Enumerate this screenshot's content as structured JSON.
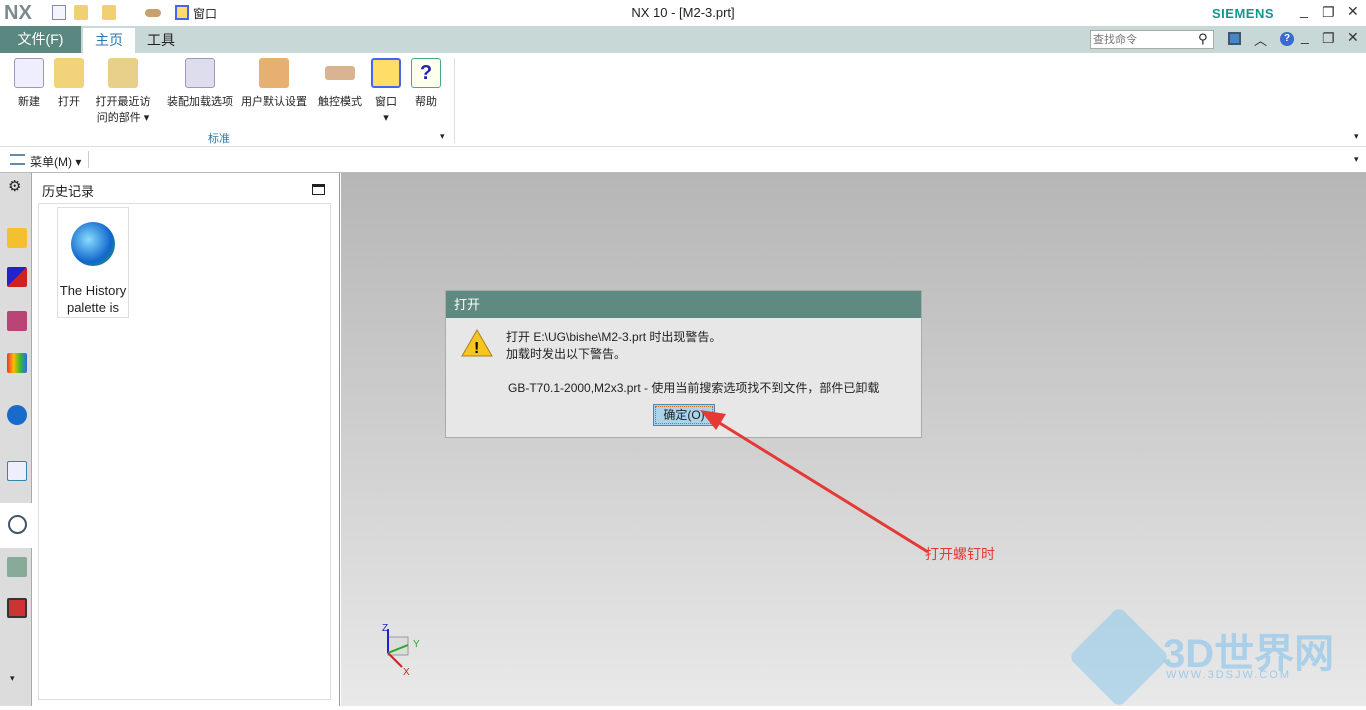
{
  "app": {
    "logo": "NX",
    "title": "NX 10 - [M2-3.prt]",
    "brand": "SIEMENS",
    "quick_window": "窗口"
  },
  "tabs": [
    {
      "label": "文件(F)"
    },
    {
      "label": "主页"
    },
    {
      "label": "工具"
    }
  ],
  "search": {
    "placeholder": "查找命令"
  },
  "ribbon": {
    "group": "标准",
    "buttons": [
      {
        "label": "新建",
        "icon": "new-file-icon"
      },
      {
        "label": "打开",
        "icon": "open-folder-icon"
      },
      {
        "label": "打开最近访问的部件",
        "line1": "打开最近访",
        "line2": "问的部件",
        "icon": "recent-icon"
      },
      {
        "label": "装配加载选项",
        "icon": "assembly-load-icon"
      },
      {
        "label": "用户默认设置",
        "icon": "user-defaults-icon"
      },
      {
        "label": "触控模式",
        "icon": "touch-mode-icon"
      },
      {
        "label": "窗口",
        "icon": "window-icon"
      },
      {
        "label": "帮助",
        "icon": "help-icon"
      }
    ]
  },
  "menu": {
    "label": "菜单(M)"
  },
  "history": {
    "title": "历史记录",
    "item": "The History palette is"
  },
  "dialog": {
    "title": "打开",
    "line1": "打开 E:\\UG\\bishe\\M2-3.prt 时出现警告。",
    "line2": "加载时发出以下警告。",
    "detail": "GB-T70.1-2000,M2x3.prt - 使用当前搜索选项找不到文件，部件已卸载",
    "ok": "确定(O)"
  },
  "annotation": {
    "text": "打开螺钉时",
    "color": "#e53935"
  },
  "triad": {
    "z": "Z",
    "y": "Y",
    "x": "X"
  },
  "watermark": {
    "text": "3D世界网",
    "sub": "WWW.3DSJW.COM"
  },
  "colors": {
    "accent": "#5a8880",
    "tabbar": "#c7d8d6",
    "link": "#2a7ab0"
  }
}
